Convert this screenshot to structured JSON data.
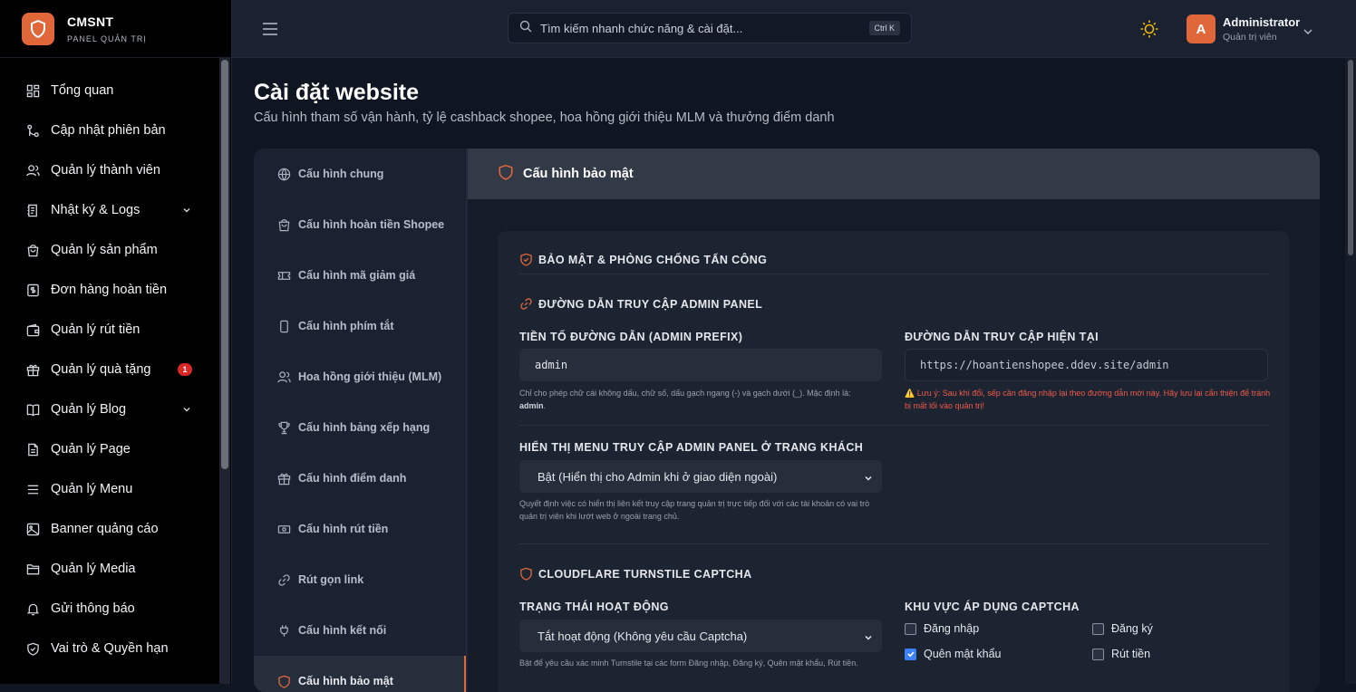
{
  "brand": {
    "name": "CMSNT",
    "subtitle": "PANEL QUẢN TRỊ"
  },
  "sidebar": {
    "items": [
      {
        "label": "Tổng quan",
        "icon": "dashboard-icon"
      },
      {
        "label": "Cập nhật phiên bản",
        "icon": "git-branch-icon"
      },
      {
        "label": "Quản lý thành viên",
        "icon": "users-icon"
      },
      {
        "label": "Nhật ký & Logs",
        "icon": "logs-icon",
        "expandable": true
      },
      {
        "label": "Quản lý sản phẩm",
        "icon": "shopping-bag-icon"
      },
      {
        "label": "Đơn hàng hoàn tiền",
        "icon": "receipt-icon"
      },
      {
        "label": "Quản lý rút tiền",
        "icon": "wallet-icon"
      },
      {
        "label": "Quản lý quà tặng",
        "icon": "gift-icon",
        "badge": "1"
      },
      {
        "label": "Quản lý Blog",
        "icon": "book-icon",
        "expandable": true
      },
      {
        "label": "Quản lý Page",
        "icon": "file-icon"
      },
      {
        "label": "Quản lý Menu",
        "icon": "menu-icon"
      },
      {
        "label": "Banner quảng cáo",
        "icon": "image-icon"
      },
      {
        "label": "Quản lý Media",
        "icon": "folder-icon"
      },
      {
        "label": "Gửi thông báo",
        "icon": "bell-icon"
      },
      {
        "label": "Vai trò & Quyền hạn",
        "icon": "shield-icon"
      }
    ]
  },
  "topbar": {
    "search_placeholder": "Tìm kiếm nhanh chức năng & cài đặt...",
    "shortcut": "Ctrl K",
    "user": {
      "initial": "A",
      "name": "Administrator",
      "role": "Quản trị viên"
    }
  },
  "page": {
    "title": "Cài đặt website",
    "subtitle": "Cấu hình tham số vận hành, tỷ lệ cashback shopee, hoa hồng giới thiệu MLM và thưởng điểm danh"
  },
  "tabs": [
    {
      "label": "Cấu hình chung",
      "icon": "globe-icon"
    },
    {
      "label": "Cấu hình hoàn tiền Shopee",
      "icon": "shopping-bag-icon"
    },
    {
      "label": "Cấu hình mã giảm giá",
      "icon": "ticket-icon"
    },
    {
      "label": "Cấu hình phím tắt",
      "icon": "phone-icon"
    },
    {
      "label": "Hoa hồng giới thiệu (MLM)",
      "icon": "users-icon"
    },
    {
      "label": "Cấu hình bảng xếp hạng",
      "icon": "trophy-icon"
    },
    {
      "label": "Cấu hình điểm danh",
      "icon": "gift-icon"
    },
    {
      "label": "Cấu hình rút tiền",
      "icon": "cash-icon"
    },
    {
      "label": "Rút gọn link",
      "icon": "link-icon"
    },
    {
      "label": "Cấu hình kết nối",
      "icon": "plug-icon"
    },
    {
      "label": "Cấu hình bảo mật",
      "icon": "shield-icon",
      "active": true
    }
  ],
  "content": {
    "header": "Cấu hình bảo mật",
    "section_security": "BẢO MẬT & PHÒNG CHỐNG TẤN CÔNG",
    "section_admin_path": "ĐƯỜNG DẪN TRUY CẬP ADMIN PANEL",
    "prefix_label": "TIỀN TỐ ĐƯỜNG DẪN (ADMIN PREFIX)",
    "prefix_value": "admin",
    "prefix_help": "Chỉ cho phép chữ cái không dấu, chữ số, dấu gạch ngang (-) và gạch dưới (_). Mặc định là:",
    "prefix_help_default": "admin",
    "current_path_label": "ĐƯỜNG DẪN TRUY CẬP HIỆN TẠI",
    "current_path_value": "https://hoantienshopee.ddev.site/admin",
    "current_path_warning": "⚠️ Lưu ý: Sau khi đổi, sếp cần đăng nhập lại theo đường dẫn mới này. Hãy lưu lại cẩn thiện để tránh bị mất lối vào quản trị!",
    "menu_label": "HIỂN THỊ MENU TRUY CẬP ADMIN PANEL Ở TRANG KHÁCH",
    "menu_value": "Bật (Hiển thị cho Admin khi ở giao diện ngoài)",
    "menu_help": "Quyết định việc có hiển thị liên kết truy cập trang quản trị trực tiếp đối với các tài khoản có vai trò quản trị viên khi lướt web ở ngoài trang chủ.",
    "section_captcha": "CLOUDFLARE TURNSTILE CAPTCHA",
    "status_label": "TRẠNG THÁI HOẠT ĐỘNG",
    "status_value": "Tắt hoạt động (Không yêu cầu Captcha)",
    "status_help": "Bật để yêu cầu xác minh Turnstile tại các form Đăng nhập, Đăng ký, Quên mật khẩu, Rút tiền.",
    "area_label": "KHU VỰC ÁP DỤNG CAPTCHA",
    "areas": [
      {
        "label": "Đăng nhập",
        "checked": false
      },
      {
        "label": "Đăng ký",
        "checked": false
      },
      {
        "label": "Quên mật khẩu",
        "checked": true
      },
      {
        "label": "Rút tiền",
        "checked": false
      }
    ]
  },
  "colors": {
    "accent": "#e0673a",
    "checkbox": "#3b82f6",
    "warning": "#ef5b4b"
  }
}
